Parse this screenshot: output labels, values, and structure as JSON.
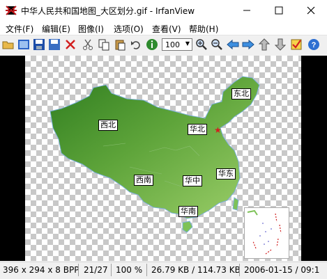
{
  "window": {
    "title": "中华人民共和国地图_大区划分.gif - IrfanView"
  },
  "menu": [
    "文件(F)",
    "编辑(E)",
    "图像(I)",
    "选项(O)",
    "查看(V)",
    "帮助(H)"
  ],
  "toolbar": {
    "zoom_value": "100"
  },
  "map": {
    "regions": [
      "东北",
      "西北",
      "华北",
      "西南",
      "华中",
      "华东",
      "华南"
    ]
  },
  "status": {
    "dimensions": "396 x 294 x 8 BPP",
    "index": "21/27",
    "zoom": "100 %",
    "filesize": "26.79 KB / 114.73 KB",
    "datetime": "2006-01-15 / 09:1"
  }
}
